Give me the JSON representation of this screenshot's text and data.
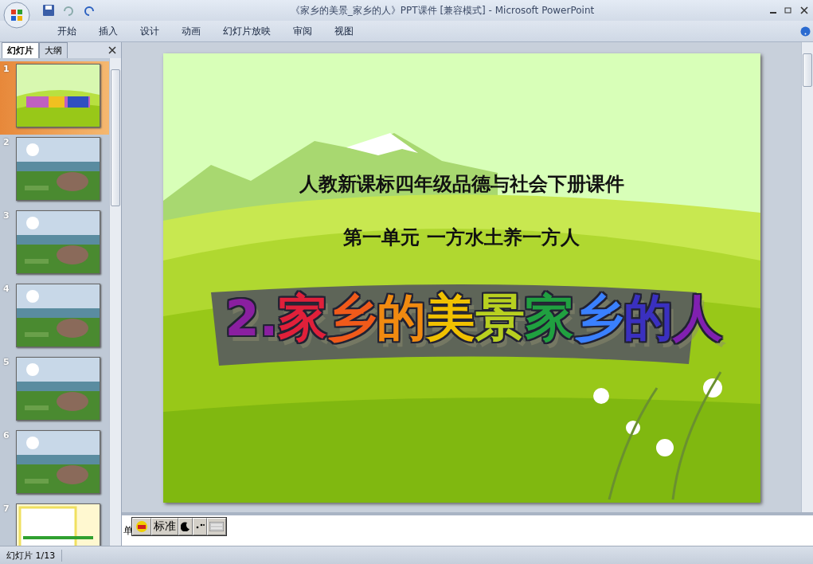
{
  "window": {
    "title": "《家乡的美景_家乡的人》PPT课件 [兼容模式] - Microsoft PowerPoint"
  },
  "ribbon_tabs": [
    {
      "label": "开始",
      "selected": false
    },
    {
      "label": "插入",
      "selected": false
    },
    {
      "label": "设计",
      "selected": false
    },
    {
      "label": "动画",
      "selected": false
    },
    {
      "label": "幻灯片放映",
      "selected": false
    },
    {
      "label": "审阅",
      "selected": false
    },
    {
      "label": "视图",
      "selected": false
    }
  ],
  "pane_tabs": [
    {
      "label": "幻灯片",
      "selected": true
    },
    {
      "label": "大纲",
      "selected": false
    }
  ],
  "thumbnails": [
    {
      "number": "1",
      "selected": true,
      "kind": "title"
    },
    {
      "number": "2",
      "selected": false,
      "kind": "picture"
    },
    {
      "number": "3",
      "selected": false,
      "kind": "picture"
    },
    {
      "number": "4",
      "selected": false,
      "kind": "picture"
    },
    {
      "number": "5",
      "selected": false,
      "kind": "picture"
    },
    {
      "number": "6",
      "selected": false,
      "kind": "picture"
    },
    {
      "number": "7",
      "selected": false,
      "kind": "text"
    }
  ],
  "slide": {
    "line_1": "人教新课标四年级品德与社会下册课件",
    "line_2": "第一单元 一方水土养一方人",
    "title_chars": [
      {
        "text": "2.",
        "color": "#8a1fa0"
      },
      {
        "text": "家",
        "color": "#e0203a"
      },
      {
        "text": "乡",
        "color": "#f05a1a"
      },
      {
        "text": "的",
        "color": "#f08a10"
      },
      {
        "text": "美",
        "color": "#f0c000"
      },
      {
        "text": "景",
        "color": "#b8d020"
      },
      {
        "text": "家",
        "color": "#20a040"
      },
      {
        "text": "乡",
        "color": "#3a80ff"
      },
      {
        "text": "的",
        "color": "#3a30c0"
      },
      {
        "text": "人",
        "color": "#8020b0"
      }
    ]
  },
  "notes": {
    "text": "单"
  },
  "ime_bar": {
    "mode": "标准"
  },
  "status_bar": {
    "text": "幻灯片 1/13"
  }
}
